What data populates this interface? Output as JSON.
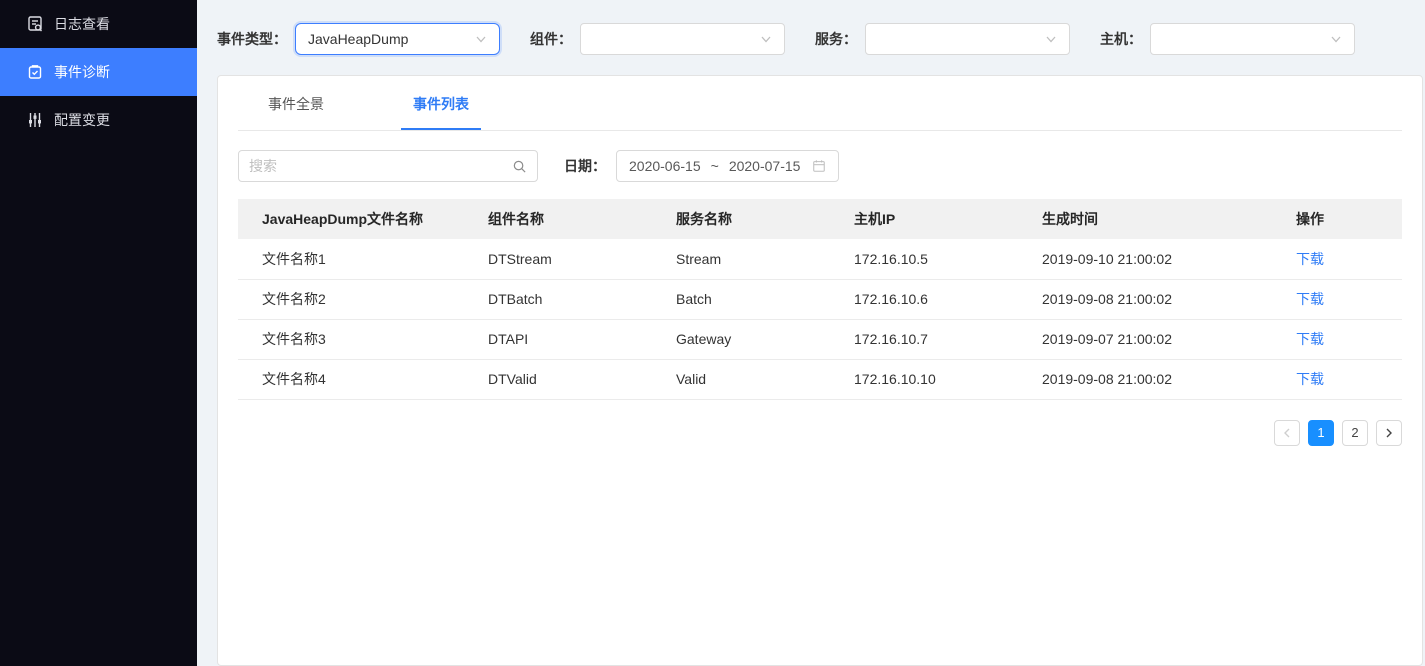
{
  "colors": {
    "sidebar_bg": "#0B0B15",
    "sidebar_active": "#3D7EFF",
    "accent_link": "#2F7CF6",
    "pagination_active": "#188FFF",
    "content_bg": "#EFF3F7"
  },
  "sidebar": {
    "items": [
      {
        "label": "日志查看",
        "icon": "log-search-icon",
        "active": false
      },
      {
        "label": "事件诊断",
        "icon": "clipboard-check-icon",
        "active": true
      },
      {
        "label": "配置变更",
        "icon": "sliders-icon",
        "active": false
      }
    ]
  },
  "filters": [
    {
      "label": "事件类型：",
      "value": "JavaHeapDump",
      "focused": true
    },
    {
      "label": "组件：",
      "value": ""
    },
    {
      "label": "服务：",
      "value": ""
    },
    {
      "label": "主机：",
      "value": ""
    }
  ],
  "tabs": [
    {
      "label": "事件全景",
      "active": false
    },
    {
      "label": "事件列表",
      "active": true
    }
  ],
  "search": {
    "placeholder": "搜索"
  },
  "date": {
    "label": "日期：",
    "start": "2020-06-15",
    "separator": "~",
    "end": "2020-07-15"
  },
  "table": {
    "columns": [
      "JavaHeapDump文件名称",
      "组件名称",
      "服务名称",
      "主机IP",
      "生成时间",
      "操作"
    ],
    "rows": [
      {
        "file": "文件名称1",
        "component": "DTStream",
        "service": "Stream",
        "ip": "172.16.10.5",
        "time": "2019-09-10  21:00:02",
        "action": "下载"
      },
      {
        "file": "文件名称2",
        "component": "DTBatch",
        "service": "Batch",
        "ip": "172.16.10.6",
        "time": "2019-09-08  21:00:02",
        "action": "下载"
      },
      {
        "file": "文件名称3",
        "component": "DTAPI",
        "service": "Gateway",
        "ip": "172.16.10.7",
        "time": "2019-09-07  21:00:02",
        "action": "下载"
      },
      {
        "file": "文件名称4",
        "component": "DTValid",
        "service": "Valid",
        "ip": "172.16.10.10",
        "time": "2019-09-08  21:00:02",
        "action": "下载"
      }
    ]
  },
  "pagination": {
    "prev": "‹",
    "next": "›",
    "pages": [
      "1",
      "2"
    ],
    "active": "1"
  }
}
